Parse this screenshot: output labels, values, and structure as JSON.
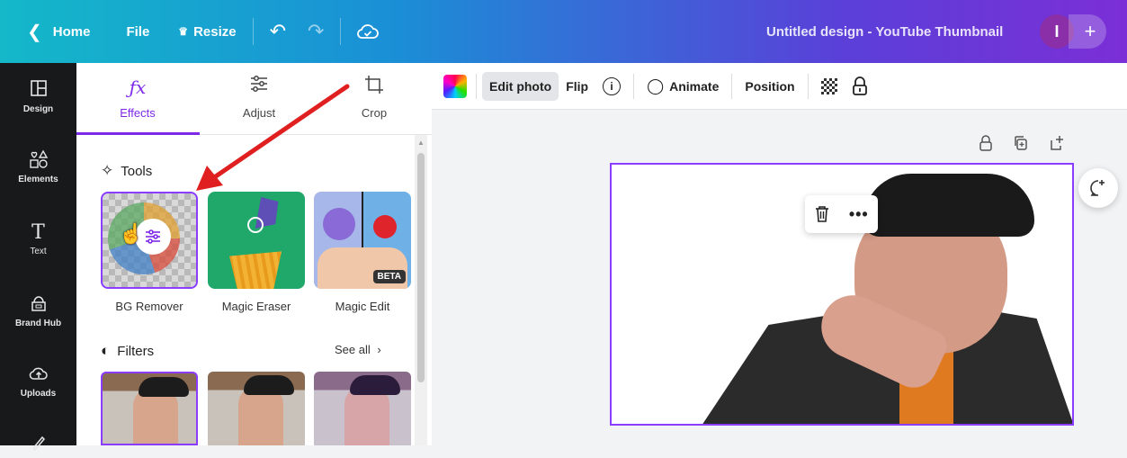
{
  "topbar": {
    "home_label": "Home",
    "file_label": "File",
    "resize_label": "Resize",
    "design_title": "Untitled design - YouTube Thumbnail",
    "avatar_initial": "I",
    "add_label": "+"
  },
  "rail": {
    "items": [
      {
        "label": "Design",
        "icon": "layout-icon"
      },
      {
        "label": "Elements",
        "icon": "shapes-icon"
      },
      {
        "label": "Text",
        "icon": "text-icon"
      },
      {
        "label": "Brand Hub",
        "icon": "brand-icon"
      },
      {
        "label": "Uploads",
        "icon": "upload-icon"
      }
    ]
  },
  "panel": {
    "tabs": [
      {
        "label": "Effects",
        "icon": "fx"
      },
      {
        "label": "Adjust",
        "icon": "sliders-icon"
      },
      {
        "label": "Crop",
        "icon": "crop-icon"
      }
    ],
    "tools_title": "Tools",
    "tools": [
      {
        "label": "BG Remover"
      },
      {
        "label": "Magic Eraser"
      },
      {
        "label": "Magic Edit",
        "badge": "BETA"
      }
    ],
    "filters_title": "Filters",
    "see_all": "See all"
  },
  "toolbar": {
    "edit_photo": "Edit photo",
    "flip": "Flip",
    "animate": "Animate",
    "position": "Position"
  },
  "colors": {
    "accent": "#7d2ae8",
    "selection": "#8b3dff",
    "arrow": "#e02020"
  }
}
